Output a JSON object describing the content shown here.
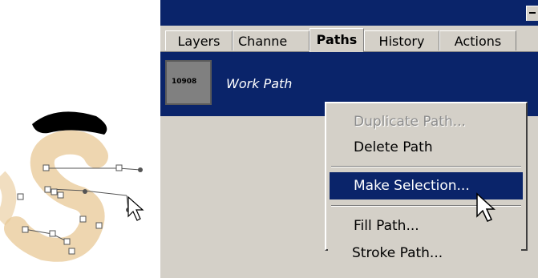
{
  "palette": {
    "title_bar": "#0a246a",
    "panel_bg": "#d4d0c8",
    "highlight": "#0a246a",
    "disabled_text": "#8c8c8c"
  },
  "tabs": [
    {
      "label": "Layers",
      "active": false
    },
    {
      "label": "Channe",
      "active": false
    },
    {
      "label": "Paths",
      "active": true
    },
    {
      "label": "History",
      "active": false
    },
    {
      "label": "Actions",
      "active": false
    }
  ],
  "paths": {
    "items": [
      {
        "name": "Work Path",
        "thumbnail_text": "10908"
      }
    ]
  },
  "context_menu": {
    "items": [
      {
        "label": "Duplicate Path...",
        "state": "disabled"
      },
      {
        "label": "Delete Path",
        "state": "normal"
      },
      {
        "label": "Make Selection...",
        "state": "highlighted"
      },
      {
        "label": "Fill Path...",
        "state": "normal"
      },
      {
        "label": "Stroke Path...",
        "state": "normal"
      }
    ]
  },
  "icons": {
    "panel_menu": "panel-menu-icon",
    "cursor": "arrow-cursor-icon"
  }
}
